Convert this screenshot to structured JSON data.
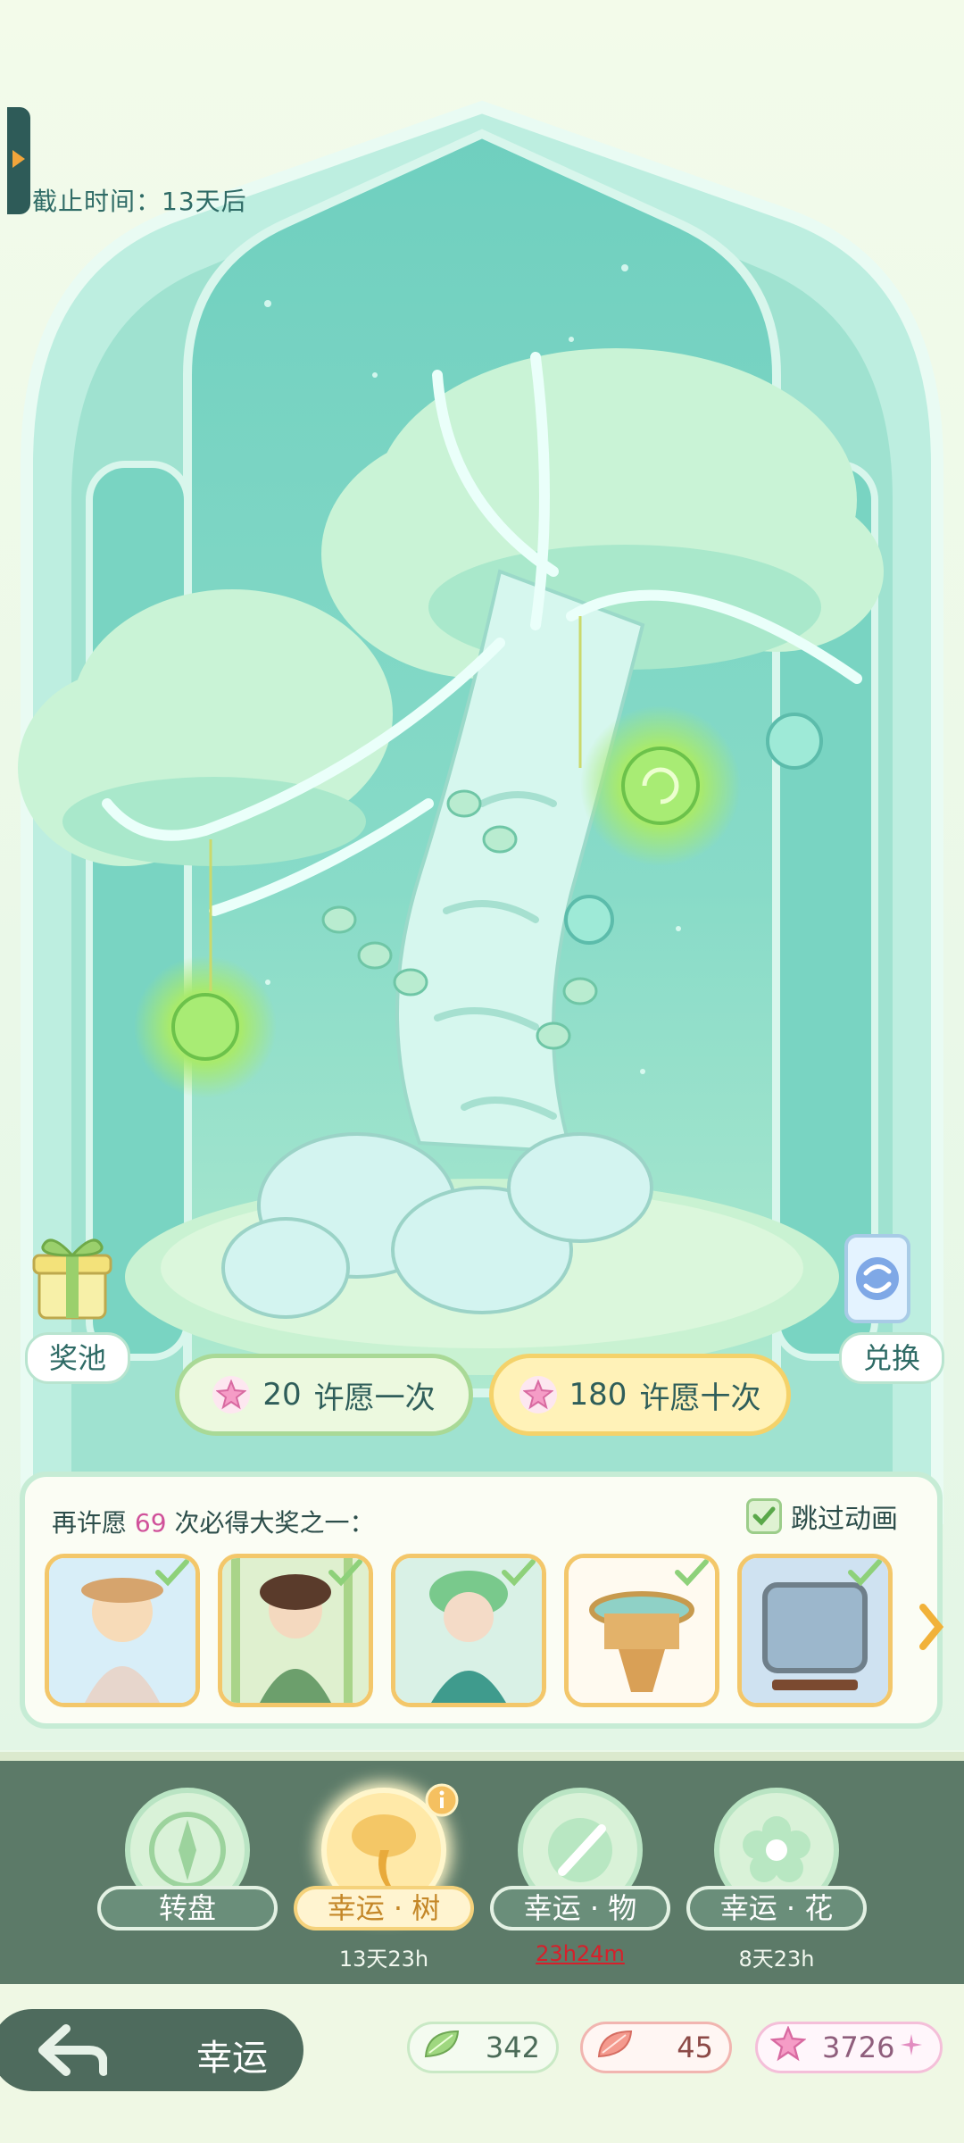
{
  "deadline": "截止时间：13天后",
  "side_buttons": {
    "prize_pool": "奖池",
    "exchange": "兑换"
  },
  "wish_buttons": [
    {
      "cost": "20",
      "label": "许愿一次"
    },
    {
      "cost": "180",
      "label": "许愿十次"
    }
  ],
  "reward_panel": {
    "text_before": "再许愿",
    "count": "69",
    "text_after": "次必得大奖之一：",
    "skip_label": "跳过动画"
  },
  "nav": [
    {
      "label": "转盘",
      "time": ""
    },
    {
      "label": "幸运 · 树",
      "time": "13天23h"
    },
    {
      "label": "幸运 · 物",
      "time": "23h24m"
    },
    {
      "label": "幸运 · 花",
      "time": "8天23h"
    }
  ],
  "footer": {
    "page_name": "幸运",
    "currencies": {
      "leaf": "342",
      "red_leaf": "45",
      "star": "3726"
    }
  },
  "colors": {
    "accent_green": "#5c7a68",
    "gold_border": "#f3c76a",
    "count_pink": "#d0519a",
    "timer_red": "#d6202b"
  }
}
